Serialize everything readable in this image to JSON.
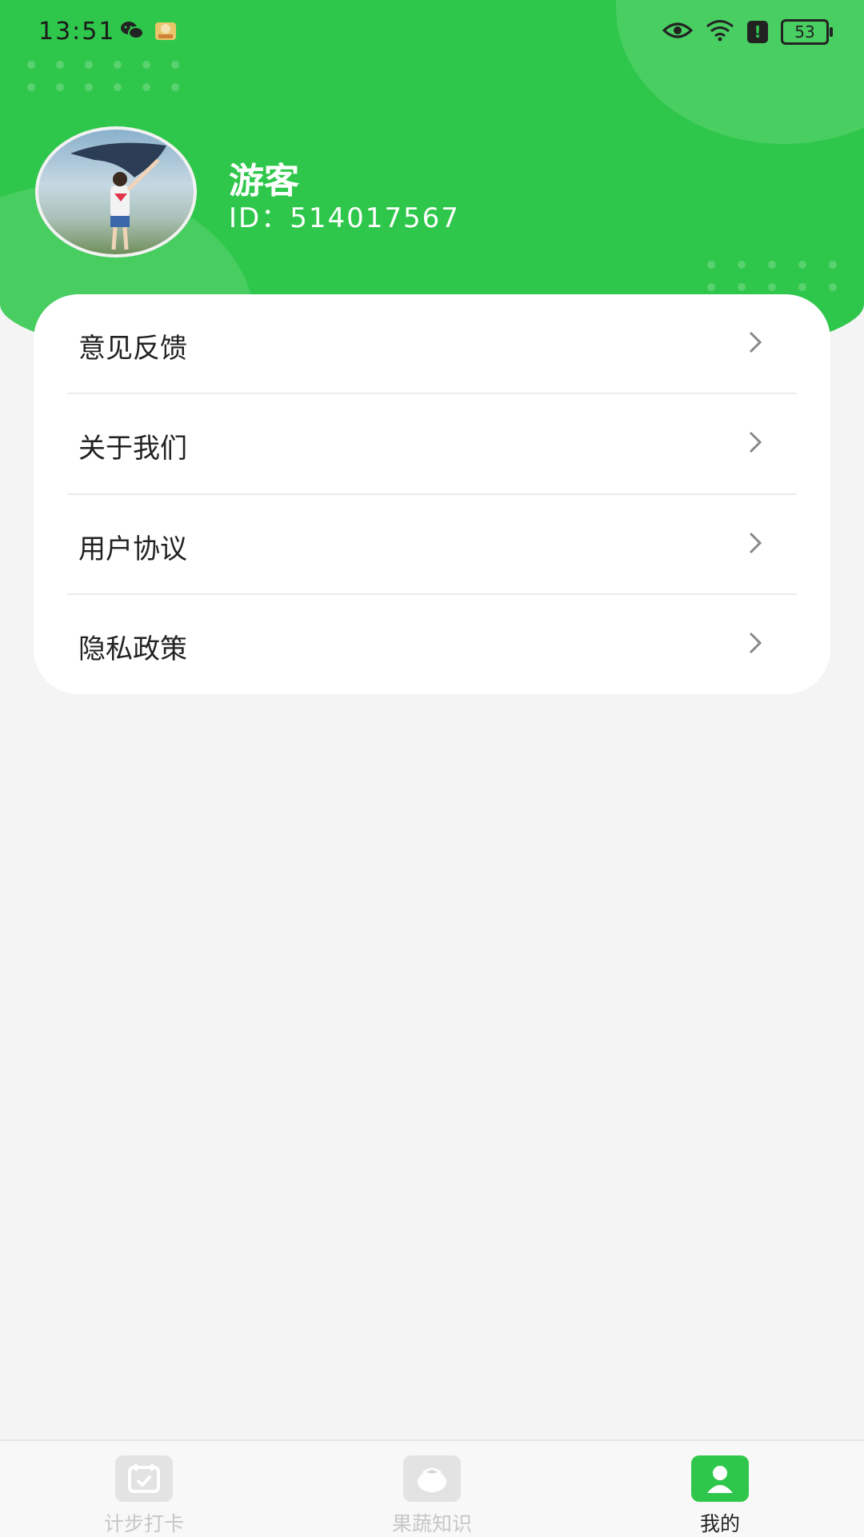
{
  "status_bar": {
    "time": "13:51",
    "left_icons": [
      "wechat-icon",
      "app-notification-icon"
    ],
    "right_icons": [
      "eye-icon",
      "wifi-icon",
      "alert-icon"
    ],
    "battery": "53"
  },
  "profile": {
    "name": "游客",
    "id_text": "ID：514017567"
  },
  "menu": {
    "items": [
      {
        "label": "意见反馈"
      },
      {
        "label": "关于我们"
      },
      {
        "label": "用户协议"
      },
      {
        "label": "隐私政策"
      }
    ]
  },
  "tabbar": {
    "tabs": [
      {
        "label": "计步打卡",
        "active": false,
        "icon": "calendar-check-icon"
      },
      {
        "label": "果蔬知识",
        "active": false,
        "icon": "fruit-icon"
      },
      {
        "label": "我的",
        "active": true,
        "icon": "user-icon"
      }
    ]
  },
  "colors": {
    "brand_green": "#2fc74b",
    "background": "#f4f4f4",
    "inactive_tab": "#c6c6c6"
  }
}
